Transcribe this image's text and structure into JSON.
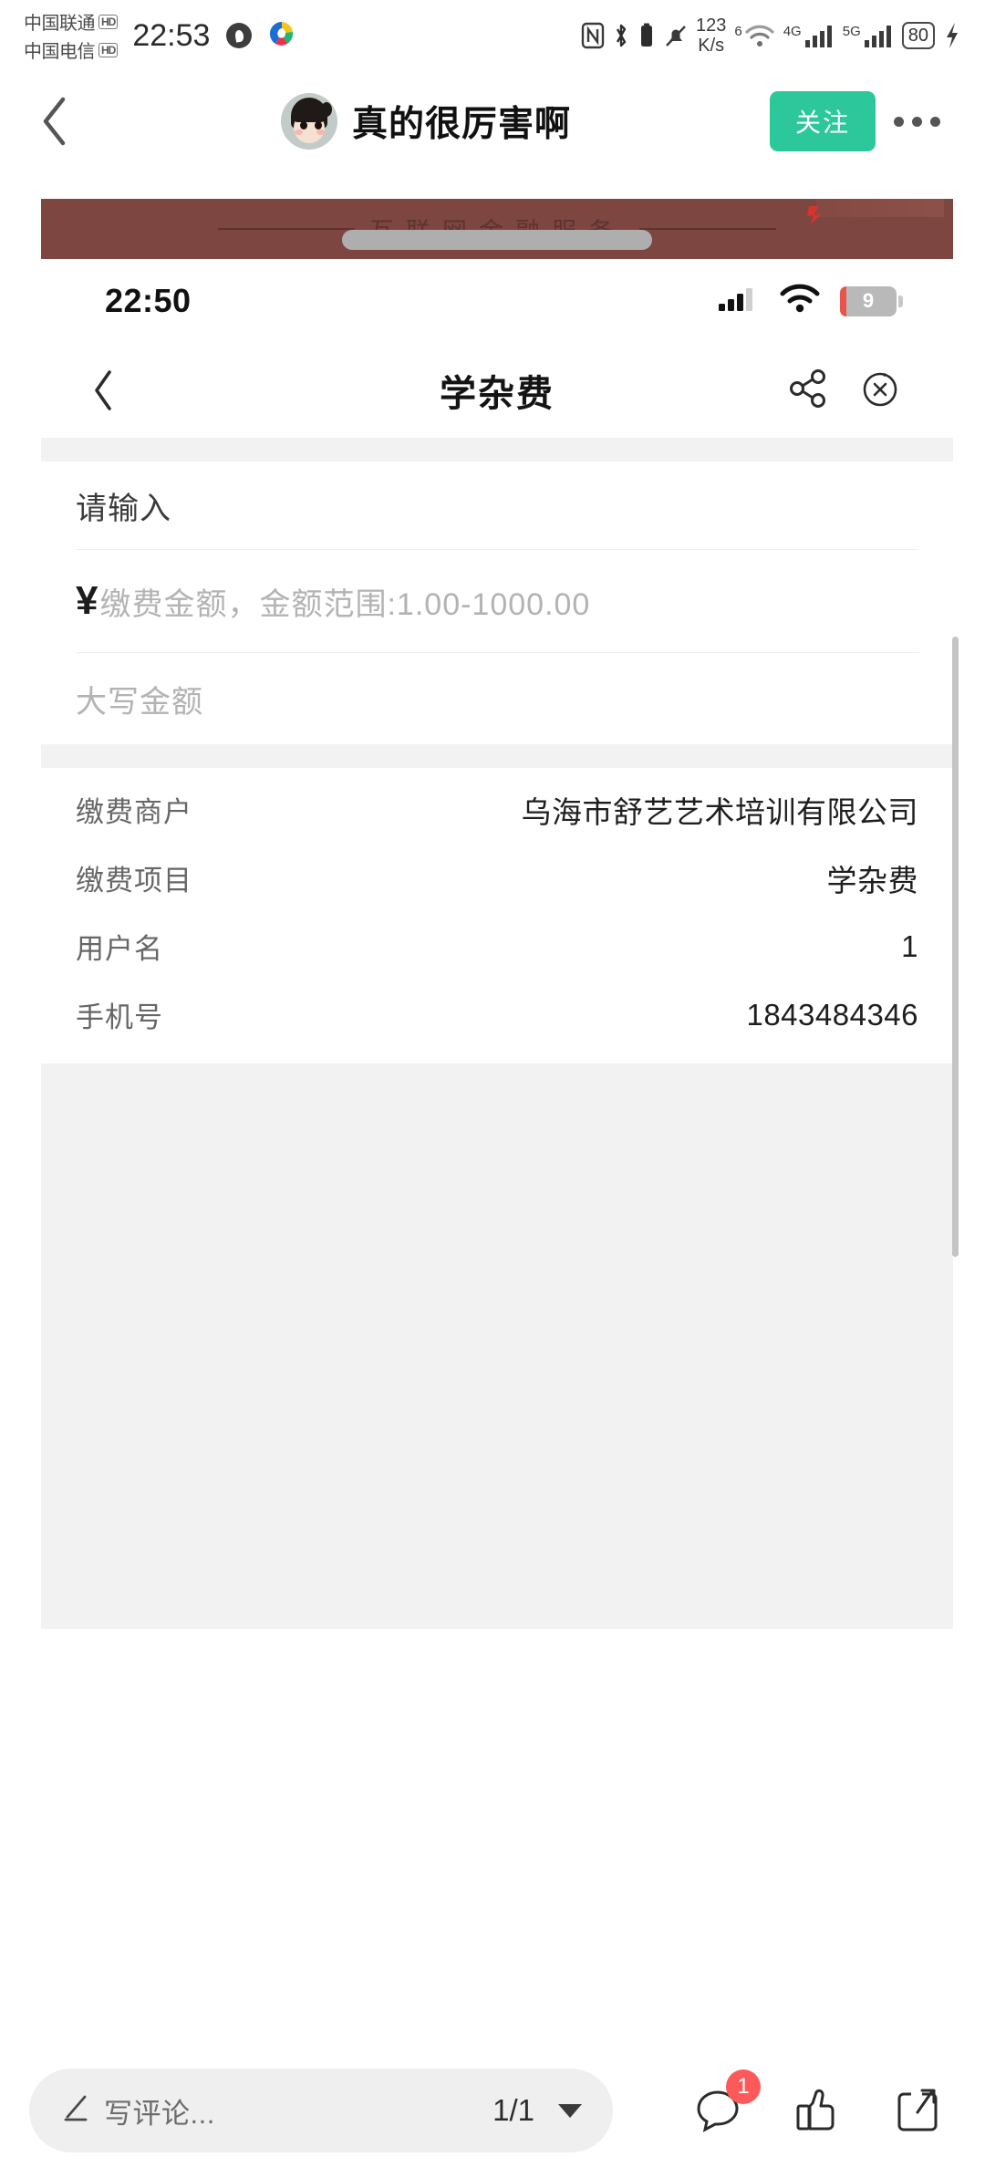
{
  "os_status": {
    "carrier1": "中国联通",
    "carrier2": "中国电信",
    "hd_badge": "HD",
    "clock": "22:53",
    "netspeed_value": "123",
    "netspeed_unit": "K/s",
    "wifi_label": "6",
    "net4g_label": "4G",
    "net5g_label": "5G",
    "battery": "80",
    "icons": [
      "nfc-icon",
      "bluetooth-icon",
      "silent-icon",
      "wifi-icon",
      "signal-4g-icon",
      "signal-5g-icon",
      "battery-charging-icon"
    ]
  },
  "app_header": {
    "back_icon": "back-chevron-icon",
    "username": "真的很厉害啊",
    "follow_label": "关注",
    "more_icon": "more-dots-icon"
  },
  "banner": {
    "text": "互联网金融服务",
    "color": "#7d4641"
  },
  "inner_status": {
    "time": "22:50",
    "battery": "9",
    "icons": [
      "signal-bars-icon",
      "wifi-icon",
      "battery-icon"
    ]
  },
  "inner_page": {
    "title": "学杂费",
    "back_icon": "back-chevron-icon",
    "share_icon": "share-nodes-icon",
    "close_icon": "close-circle-icon"
  },
  "form": {
    "name_placeholder": "请输入",
    "currency_symbol": "¥",
    "amount_placeholder": "缴费金额，金额范围:1.00-1000.00",
    "uppercase_label": "大写金额"
  },
  "info_rows": [
    {
      "label": "缴费商户",
      "value": "乌海市舒艺艺术培训有限公司"
    },
    {
      "label": "缴费项目",
      "value": "学杂费"
    },
    {
      "label": "用户名",
      "value": "1"
    },
    {
      "label": "手机号",
      "value": "1843484346"
    }
  ],
  "bottom_bar": {
    "comment_icon": "pencil-icon",
    "comment_placeholder": "写评论...",
    "pager": "1/1",
    "caret_icon": "chevron-down-icon",
    "comment_count": "1",
    "comment_bubble_icon": "comment-bubble-icon",
    "like_icon": "thumbs-up-icon",
    "share_icon": "share-arrow-icon"
  }
}
